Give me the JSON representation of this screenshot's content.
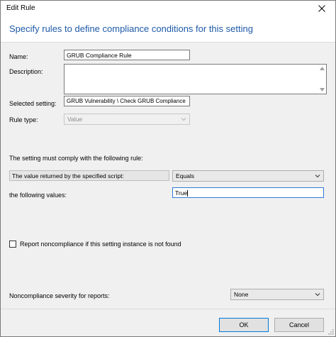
{
  "window": {
    "title": "Edit Rule"
  },
  "header": {
    "text": "Specify rules to define compliance conditions for this setting"
  },
  "form": {
    "name_label": "Name:",
    "name_value": "GRUB Compliance Rule",
    "description_label": "Description:",
    "description_value": "",
    "selected_setting_label": "Selected setting:",
    "selected_setting_value": "GRUB Vulnerability \\ Check GRUB Compliance",
    "rule_type_label": "Rule type:",
    "rule_type_value": "Value"
  },
  "rule": {
    "heading": "The setting must comply with the following rule:",
    "condition_text": "The value returned by the specified script:",
    "operator_value": "Equals",
    "values_label": "the following values:",
    "values_value": "True"
  },
  "report_noncompliance": {
    "label": "Report noncompliance if this setting instance is not found",
    "checked": false
  },
  "severity": {
    "label": "Noncompliance severity for reports:",
    "value": "None"
  },
  "buttons": {
    "ok": "OK",
    "cancel": "Cancel"
  },
  "colors": {
    "header_text": "#1e5aa8",
    "focus_border": "#2f7bd9",
    "primary_button_border": "#0078d7"
  }
}
